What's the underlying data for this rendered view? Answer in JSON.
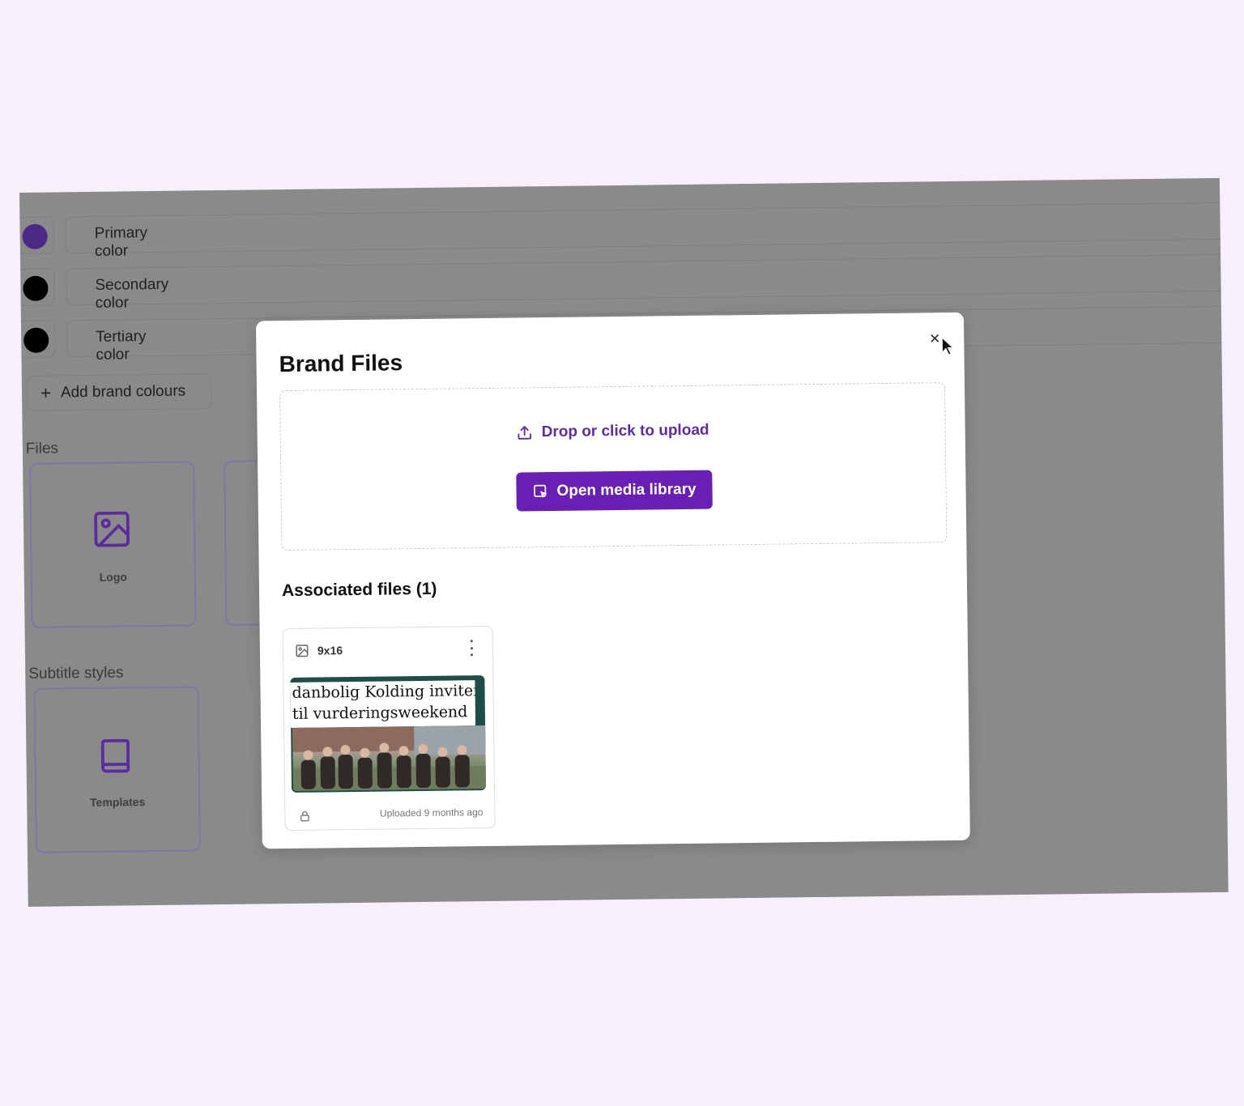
{
  "brand_colors": {
    "items": [
      {
        "label": "Primary color",
        "swatch": "#4a2a86"
      },
      {
        "label": "Secondary color",
        "swatch": "#000000"
      },
      {
        "label": "Tertiary color",
        "swatch": "#000000"
      }
    ],
    "add_label": "Add brand colours"
  },
  "files_section": {
    "title": "Files",
    "logo_label": "Logo"
  },
  "subtitle_section": {
    "title": "Subtitle styles",
    "templates_label": "Templates"
  },
  "modal": {
    "title": "Brand Files",
    "upload_text": "Drop or click to upload",
    "media_button": "Open media library",
    "associated_title": "Associated files (1)",
    "file": {
      "name": "9x16",
      "thumbnail_caption_line1": "danbolig Kolding inviterer",
      "thumbnail_caption_line2": "til vurderingsweekend",
      "uploaded": "Uploaded 9 months ago"
    }
  },
  "colors": {
    "accent": "#6a1fb4",
    "overlay": "#8a8a8a",
    "page_bg": "#f6f0fb"
  }
}
